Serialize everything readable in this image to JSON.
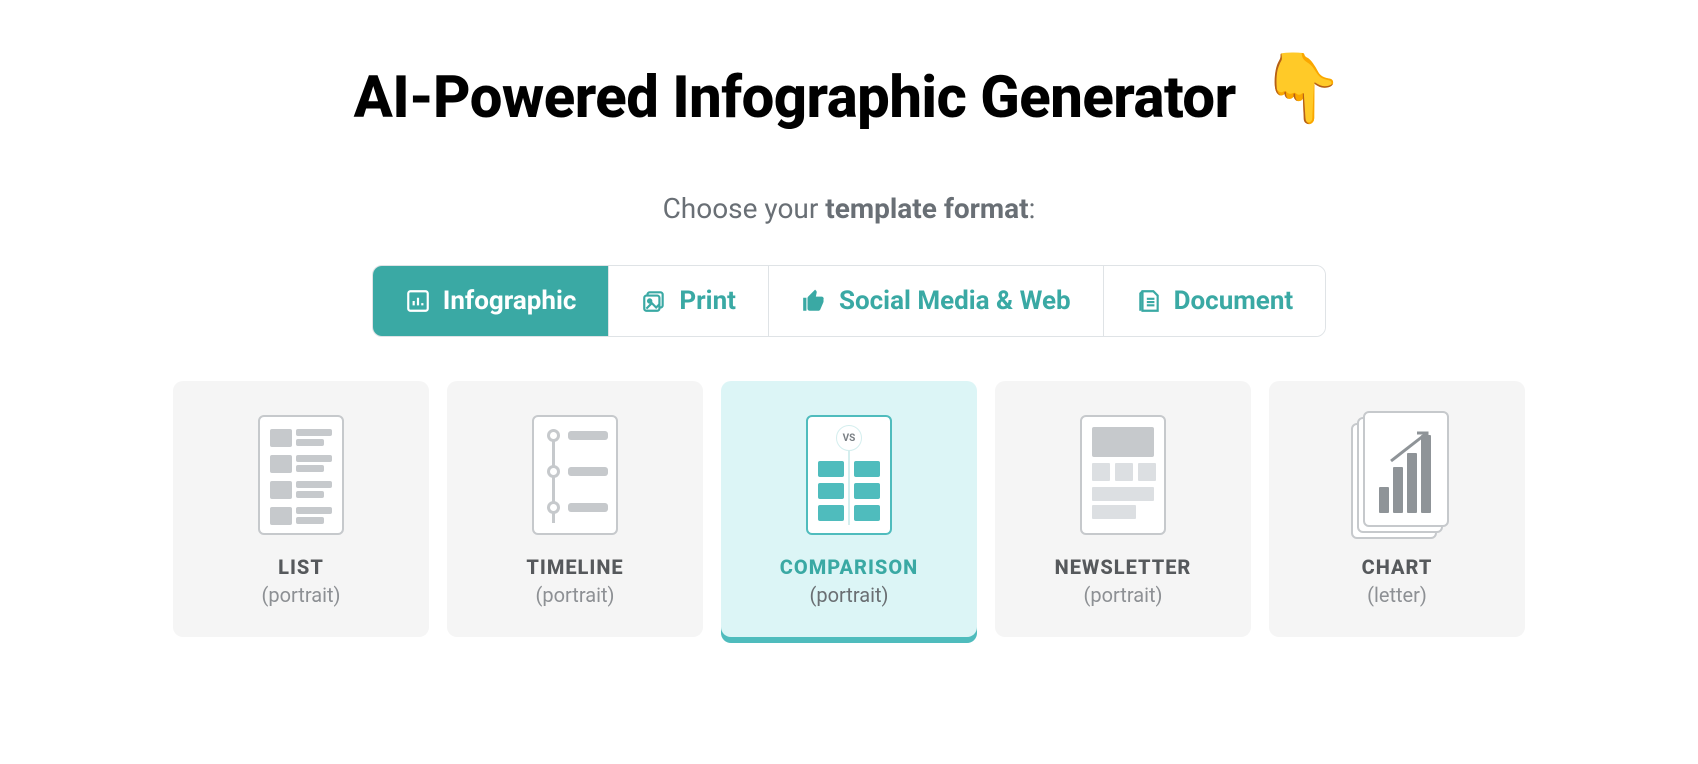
{
  "header": {
    "title": "AI-Powered Infographic Generator",
    "emoji": "👇"
  },
  "subtitle": {
    "prefix": "Choose your ",
    "bold": "template format",
    "suffix": ":"
  },
  "tabs": [
    {
      "label": "Infographic",
      "icon": "chart-bar-icon",
      "active": true
    },
    {
      "label": "Print",
      "icon": "picture-icon",
      "active": false
    },
    {
      "label": "Social Media & Web",
      "icon": "thumbs-up-icon",
      "active": false
    },
    {
      "label": "Document",
      "icon": "document-icon",
      "active": false
    }
  ],
  "templates": [
    {
      "title": "LIST",
      "subtitle": "(portrait)",
      "selected": false
    },
    {
      "title": "TIMELINE",
      "subtitle": "(portrait)",
      "selected": false
    },
    {
      "title": "COMPARISON",
      "subtitle": "(portrait)",
      "selected": true,
      "vs_label": "VS"
    },
    {
      "title": "NEWSLETTER",
      "subtitle": "(portrait)",
      "selected": false
    },
    {
      "title": "CHART",
      "subtitle": "(letter)",
      "selected": false
    }
  ],
  "colors": {
    "teal": "#3aa9a4",
    "teal_light": "#dcf5f6",
    "gray_bg": "#f5f5f5",
    "gray_text": "#56595c"
  }
}
